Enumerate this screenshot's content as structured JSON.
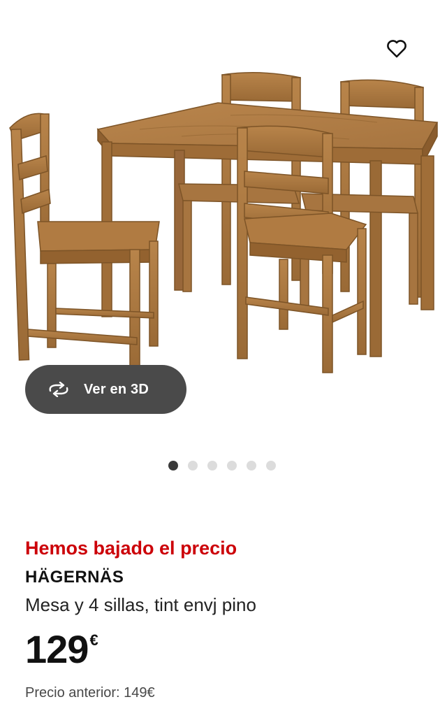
{
  "gallery": {
    "image_alt": "HÄGERNÄS mesa y 4 sillas",
    "favorite_icon": "heart-outline-icon",
    "view_3d_label": "Ver en 3D",
    "view_3d_icon": "rotate-3d-icon",
    "slide_count": 6,
    "active_slide": 1
  },
  "product": {
    "promo": "Hemos bajado el precio",
    "name": "HÄGERNÄS",
    "description": "Mesa y 4 sillas, tint envj pino",
    "price_integer": "129",
    "price_currency": "€",
    "old_price": "Precio anterior: 149€"
  },
  "colors": {
    "promo": "#cc0008",
    "button_bg": "#4a4a4a",
    "wood": "#a5733d"
  }
}
